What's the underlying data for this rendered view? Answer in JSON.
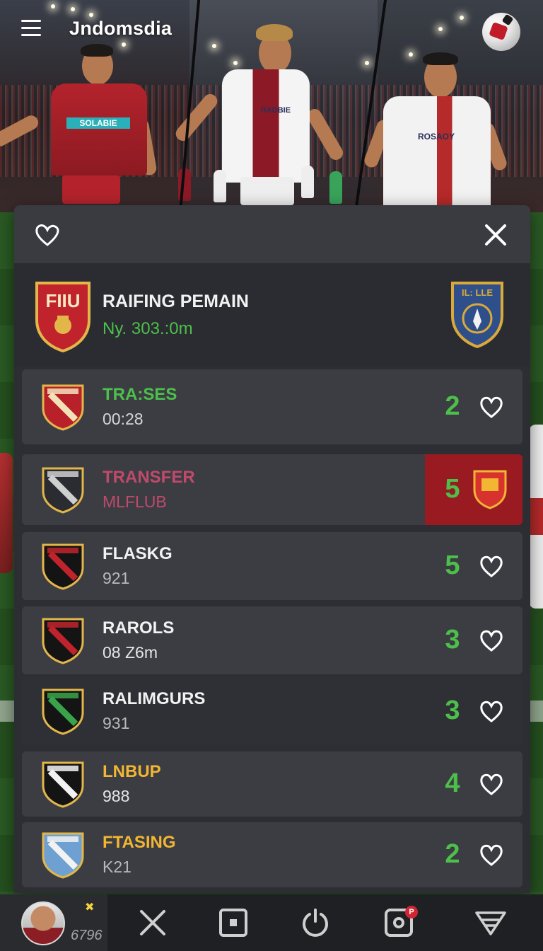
{
  "app": {
    "title": "Jndomsdia"
  },
  "hero": {
    "jersey_text_1": "SOLABIE",
    "jersey_text_2": "RADBIE",
    "jersey_text_3": "ROSAOY"
  },
  "panel": {
    "title": "RAIFING PEMAIN",
    "subtitle": "Ny. 303.:0m",
    "crest_left_text": "FIIU",
    "crest_right_text": "IL: LLE"
  },
  "rows": [
    {
      "name": "TRA:SES",
      "meta": "00:28",
      "score": "2",
      "name_color": "#4cc04a",
      "meta_color": "#d6d6d6",
      "highlighted": false
    },
    {
      "name": "TRANSFER",
      "meta": "MLFLUB",
      "score": "5",
      "name_color": "#c04a6a",
      "meta_color": "#c04a6a",
      "highlighted": true
    },
    {
      "name": "FLASKG",
      "meta": "921",
      "score": "5",
      "name_color": "#f2f2f2",
      "meta_color": "#b8b8b8",
      "highlighted": false
    },
    {
      "name": "RAROLS",
      "meta": "08 Z6m",
      "score": "3",
      "name_color": "#f2f2f2",
      "meta_color": "#e6e6e6",
      "highlighted": false
    },
    {
      "name": "RALIMGURS",
      "meta": "931",
      "score": "3",
      "name_color": "#f2f2f2",
      "meta_color": "#b8b8b8",
      "highlighted": false
    },
    {
      "name": "LNBUP",
      "meta": "988",
      "score": "4",
      "name_color": "#f2b632",
      "meta_color": "#e6e6e6",
      "highlighted": false
    },
    {
      "name": "FTASING",
      "meta": "K21",
      "score": "2",
      "name_color": "#f2b632",
      "meta_color": "#b8b8b8",
      "highlighted": false
    }
  ],
  "bottom_nav": {
    "coins": "6796",
    "badge": "P",
    "items": [
      "close-cross-icon",
      "square-target-icon",
      "power-icon",
      "camera-icon",
      "filter-icon"
    ]
  },
  "colors": {
    "accent_green": "#4cc04a",
    "highlight_red": "#9a1a22",
    "gold": "#f2b632"
  }
}
